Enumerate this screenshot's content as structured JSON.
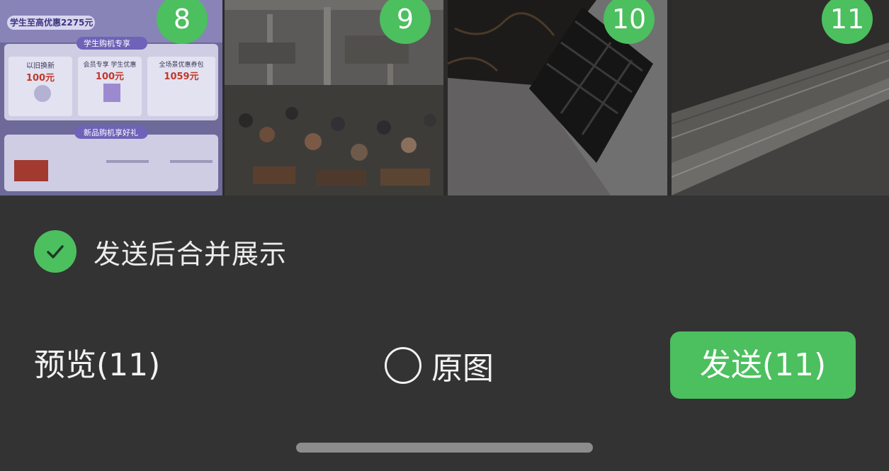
{
  "thumbnails": [
    {
      "badge": "8",
      "poster": {
        "headline": "学生至高优惠2275元",
        "section1": "学生购机专享",
        "promo_trade_in": "以旧换新",
        "promo_trade_in_value": "100元",
        "promo_member": "会员专享 学生优惠",
        "promo_member_value": "100元",
        "promo_coupon": "全场景优惠券包",
        "promo_coupon_value": "1059元",
        "section2": "新品购机享好礼"
      }
    },
    {
      "badge": "9"
    },
    {
      "badge": "10"
    },
    {
      "badge": "11"
    }
  ],
  "merge_option": {
    "label": "发送后合并展示",
    "checked": true
  },
  "bottom_bar": {
    "preview_label": "预览(11)",
    "original_label": "原图",
    "original_checked": false,
    "send_label": "发送(11)"
  },
  "colors": {
    "accent": "#4cbf5f",
    "background": "#333333"
  }
}
